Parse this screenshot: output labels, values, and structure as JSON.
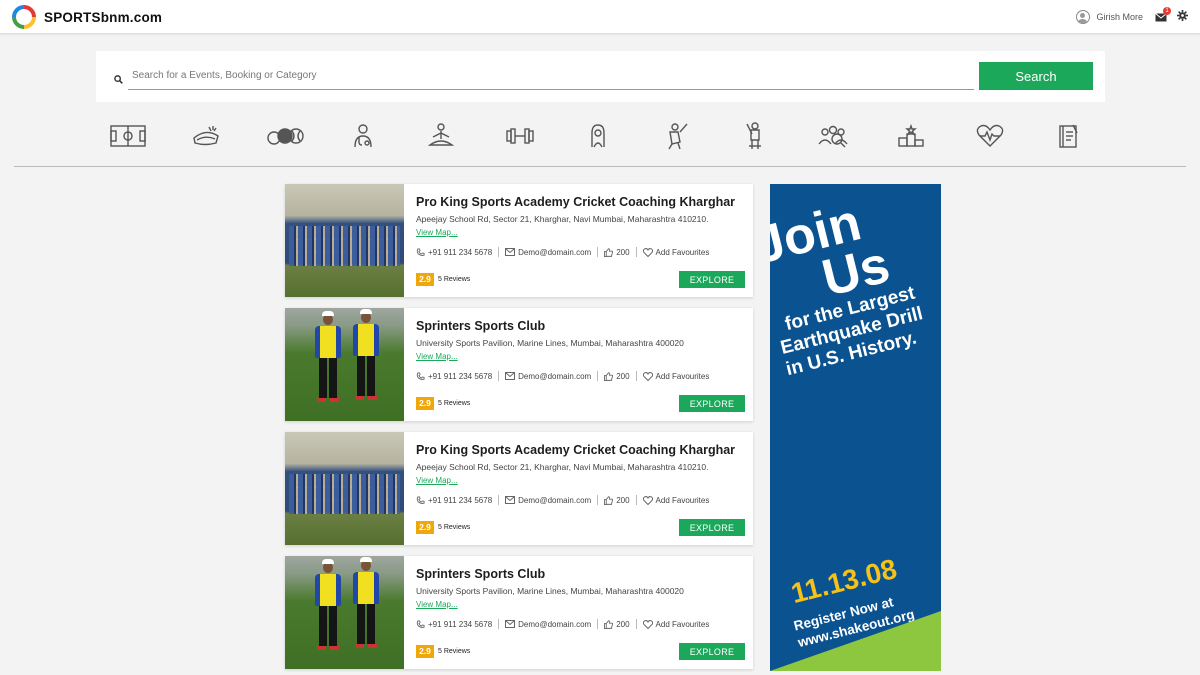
{
  "header": {
    "logo_text": "SPORTSbnm.com",
    "user_name": "Girish More",
    "mail_badge": "1"
  },
  "search": {
    "placeholder": "Search for a Events, Booking or Category",
    "button_label": "Search"
  },
  "categories": [
    "stadium-icon",
    "cricket-ball-icon",
    "sports-balls-icon",
    "physio-icon",
    "yoga-icon",
    "dumbbell-icon",
    "trainer-icon",
    "cricketer-icon",
    "batsman-icon",
    "community-icon",
    "podium-icon",
    "heart-health-icon",
    "diary-icon"
  ],
  "listings": [
    {
      "title": "Pro King Sports Academy Cricket Coaching Kharghar",
      "address": "Apeejay School Rd, Sector 21, Kharghar, Navi Mumbai, Maharashtra 410210.",
      "view_map": "View Map...",
      "phone": "+91 911 234 5678",
      "email": "Demo@domain.com",
      "likes": "200",
      "favourites": "Add Favourites",
      "rating": "2.9",
      "reviews": "5 Reviews",
      "explore": "EXPLORE",
      "image": "team-photo"
    },
    {
      "title": "Sprinters Sports Club",
      "address": "University Sports Pavilion, Marine Lines, Mumbai, Maharashtra 400020",
      "view_map": "View Map...",
      "phone": "+91 911 234 5678",
      "email": "Demo@domain.com",
      "likes": "200",
      "favourites": "Add Favourites",
      "rating": "2.9",
      "reviews": "5 Reviews",
      "explore": "EXPLORE",
      "image": "two-players-photo"
    },
    {
      "title": "Pro King Sports Academy Cricket Coaching Kharghar",
      "address": "Apeejay School Rd, Sector 21, Kharghar, Navi Mumbai, Maharashtra 410210.",
      "view_map": "View Map...",
      "phone": "+91 911 234 5678",
      "email": "Demo@domain.com",
      "likes": "200",
      "favourites": "Add Favourites",
      "rating": "2.9",
      "reviews": "5 Reviews",
      "explore": "EXPLORE",
      "image": "team-photo"
    },
    {
      "title": "Sprinters Sports Club",
      "address": "University Sports Pavilion, Marine Lines, Mumbai, Maharashtra 400020",
      "view_map": "View Map...",
      "phone": "+91 911 234 5678",
      "email": "Demo@domain.com",
      "likes": "200",
      "favourites": "Add Favourites",
      "rating": "2.9",
      "reviews": "5 Reviews",
      "explore": "EXPLORE",
      "image": "two-players-photo"
    }
  ],
  "ad": {
    "line1": "Join",
    "line2": "Us",
    "line3": "for the Largest",
    "line4": "Earthquake Drill",
    "line5": "in U.S. History.",
    "date": "11.13.08",
    "register": "Register Now at",
    "url": "www.shakeout.org"
  },
  "colors": {
    "accent_green": "#1ca85a",
    "rating_amber": "#f0a70a",
    "ad_blue": "#0a5390",
    "ad_yellow": "#f6c21a",
    "ad_lime": "#8dc63f"
  }
}
